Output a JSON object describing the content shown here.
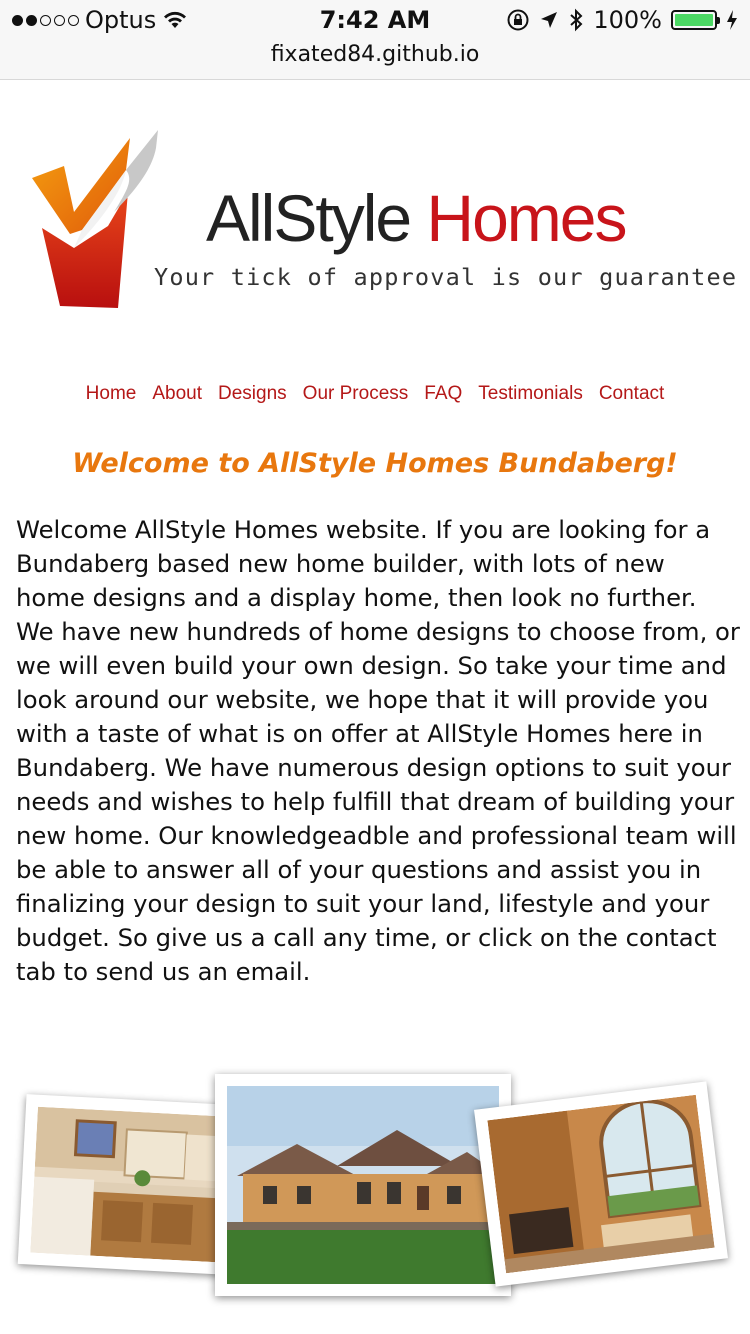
{
  "status_bar": {
    "carrier": "Optus",
    "time": "7:42 AM",
    "battery": "100%",
    "signal_bars": 2,
    "battery_level": 1.0
  },
  "url_bar": {
    "url": "fixated84.github.io"
  },
  "logo": {
    "title_part1": "AllStyle",
    "title_part2": "Homes",
    "tagline": "Your tick of approval is our guarantee"
  },
  "nav": {
    "items": [
      "Home",
      "About",
      "Designs",
      "Our Process",
      "FAQ",
      "Testimonials",
      "Contact"
    ]
  },
  "main": {
    "heading": "Welcome to AllStyle Homes Bundaberg!",
    "paragraph": "Welcome AllStyle Homes website. If you are looking for a Bundaberg based new home builder, with lots of new home designs and a display home, then look no further. We have new hundreds of home designs to choose from, or we will even build your own design. So take your time and look around our website, we hope that it will provide you with a taste of what is on offer at AllStyle Homes here in Bundaberg. We have numerous design options to suit your needs and wishes to help fulfill that dream of building your new home. Our knowledgeadble and professional team will be able to answer all of your questions and assist you in finalizing your design to suit your land, lifestyle and your budget. So give us a call any time, or click on the contact tab to send us an email."
  },
  "colors": {
    "nav_link": "#b41818",
    "heading": "#e8770e",
    "brand_red": "#c8141a",
    "battery_green": "#4cd964"
  }
}
